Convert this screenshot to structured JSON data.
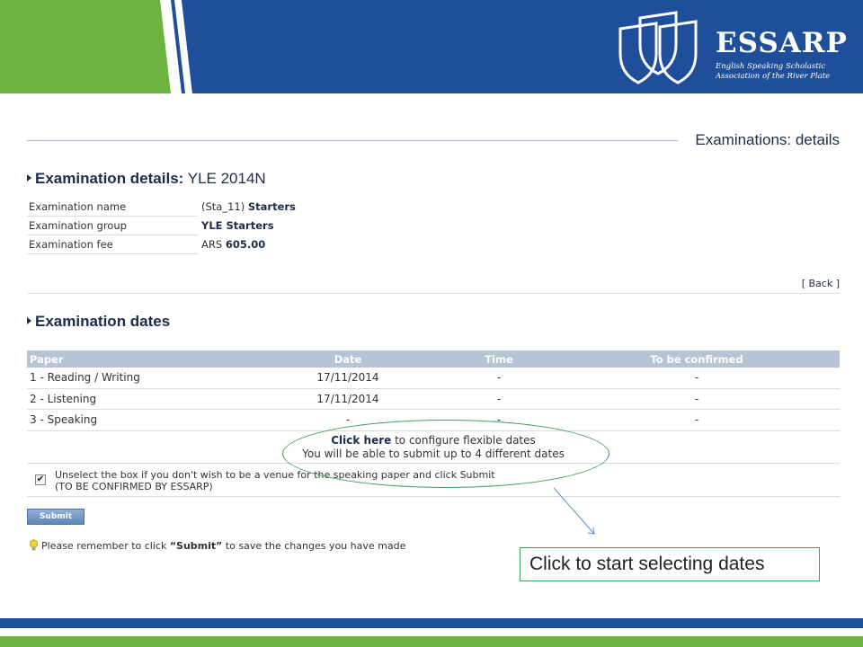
{
  "brand": {
    "name": "ESSARP",
    "tagline": "English Speaking Scholastic Association of the River Plate",
    "primary_color": "#1f4e9a",
    "accent_color": "#6db33f"
  },
  "page": {
    "title": "Examinations: details"
  },
  "details_section": {
    "heading_bold": "Examination details:",
    "heading_value": "YLE 2014N",
    "rows": [
      {
        "label": "Examination name",
        "prefix": "(Sta_11)",
        "value": "Starters"
      },
      {
        "label": "Examination group",
        "prefix": "",
        "value": "YLE Starters"
      },
      {
        "label": "Examination fee",
        "prefix": "ARS",
        "value": "605.00"
      }
    ],
    "back_label": "[ Back ]"
  },
  "dates_section": {
    "heading": "Examination dates",
    "columns": [
      "Paper",
      "Date",
      "Time",
      "To be confirmed"
    ],
    "rows": [
      {
        "paper": "1 - Reading / Writing",
        "date": "17/11/2014",
        "time": "-",
        "tbc": "-"
      },
      {
        "paper": "2 - Listening",
        "date": "17/11/2014",
        "time": "-",
        "tbc": "-"
      },
      {
        "paper": "3 - Speaking",
        "date": "-",
        "time": "-",
        "tbc": "-"
      }
    ],
    "flexible_link": "Click here",
    "flexible_text": " to configure flexible dates",
    "flexible_note": "You will be able to submit up to 4 different dates",
    "venue_checked": true,
    "venue_line1": "Unselect the box if you don't wish to be a venue for the speaking paper and click Submit",
    "venue_line2": "(TO BE CONFIRMED BY ESSARP)",
    "submit_label": "Submit",
    "reminder_pre": "Please remember to click ",
    "reminder_bold": "“Submit”",
    "reminder_post": " to save the changes you have made"
  },
  "annotation": {
    "callout_text": "Click to start selecting dates"
  }
}
